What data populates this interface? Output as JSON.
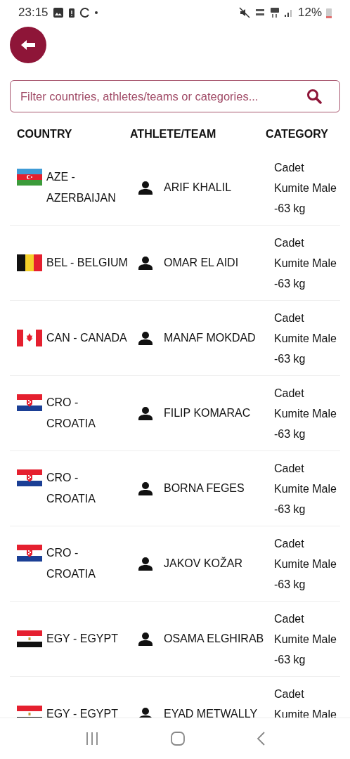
{
  "status_bar": {
    "time": "23:15",
    "battery": "12%"
  },
  "search": {
    "placeholder": "Filter countries, athletes/teams or categories..."
  },
  "table": {
    "columns": [
      "COUNTRY",
      "ATHLETE/TEAM",
      "CATEGORY"
    ],
    "rows": [
      {
        "kind": "aze",
        "country": "AZE - AZERBAIJAN",
        "athlete": "ARIF KHALIL",
        "category": [
          "Cadet",
          "Kumite Male",
          "-63 kg"
        ]
      },
      {
        "kind": "bel",
        "country": "BEL - BELGIUM",
        "athlete": "OMAR EL AIDI",
        "category": [
          "Cadet",
          "Kumite Male",
          "-63 kg"
        ]
      },
      {
        "kind": "can",
        "country": "CAN - CANADA",
        "athlete": "MANAF MOKDAD",
        "category": [
          "Cadet",
          "Kumite Male",
          "-63 kg"
        ]
      },
      {
        "kind": "cro",
        "country": "CRO - CROATIA",
        "athlete": "FILIP KOMARAC",
        "category": [
          "Cadet",
          "Kumite Male",
          "-63 kg"
        ]
      },
      {
        "kind": "cro",
        "country": "CRO - CROATIA",
        "athlete": "BORNA FEGES",
        "category": [
          "Cadet",
          "Kumite Male",
          "-63 kg"
        ]
      },
      {
        "kind": "cro",
        "country": "CRO - CROATIA",
        "athlete": "JAKOV KOŽAR",
        "category": [
          "Cadet",
          "Kumite Male",
          "-63 kg"
        ]
      },
      {
        "kind": "egy",
        "country": "EGY - EGYPT",
        "athlete": "OSAMA ELGHIRAB",
        "category": [
          "Cadet",
          "Kumite Male",
          "-63 kg"
        ]
      },
      {
        "kind": "egy",
        "country": "EGY - EGYPT",
        "athlete": "EYAD METWALLY",
        "category": [
          "Cadet",
          "Kumite Male"
        ]
      }
    ]
  }
}
